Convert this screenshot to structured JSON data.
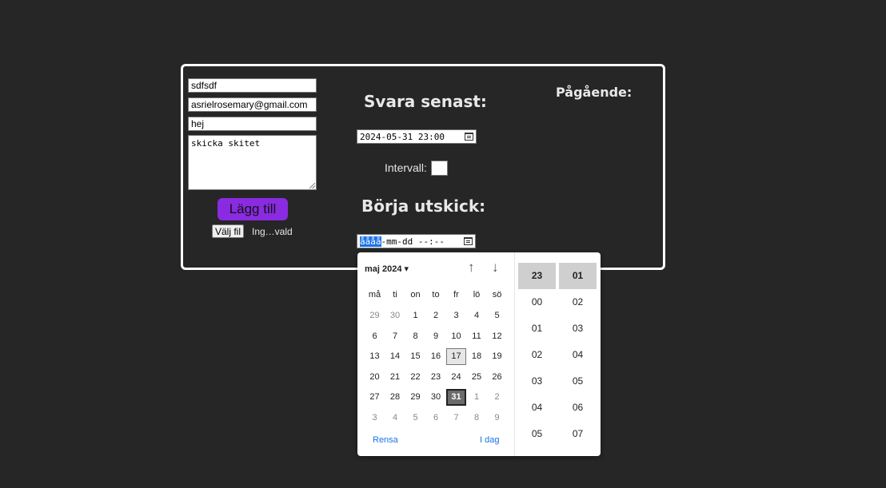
{
  "form": {
    "name_value": "sdfsdf",
    "email_value": "asrielrosemary@gmail.com",
    "subject_value": "hej",
    "message_value": "skicka skitet",
    "add_button": "Lägg till",
    "file_button": "Välj fil",
    "file_status": "Ing…vald"
  },
  "deadline": {
    "heading": "Svara senast:",
    "value": "2024-05-31 23:00",
    "interval_label": "Intervall:"
  },
  "start": {
    "heading": "Börja utskick:",
    "placeholder_selected": "åååå",
    "placeholder_rest": "-mm-dd --:--"
  },
  "ongoing": {
    "heading": "Pågående:"
  },
  "picker": {
    "month_label": "maj 2024 ▾",
    "up_arrow": "↑",
    "down_arrow": "↓",
    "weekdays": [
      "må",
      "ti",
      "on",
      "to",
      "fr",
      "lö",
      "sö"
    ],
    "weeks": [
      [
        "29",
        "30",
        "1",
        "2",
        "3",
        "4",
        "5"
      ],
      [
        "6",
        "7",
        "8",
        "9",
        "10",
        "11",
        "12"
      ],
      [
        "13",
        "14",
        "15",
        "16",
        "17",
        "18",
        "19"
      ],
      [
        "20",
        "21",
        "22",
        "23",
        "24",
        "25",
        "26"
      ],
      [
        "27",
        "28",
        "29",
        "30",
        "31",
        "1",
        "2"
      ],
      [
        "3",
        "4",
        "5",
        "6",
        "7",
        "8",
        "9"
      ]
    ],
    "today": "17",
    "selected": "31",
    "clear_label": "Rensa",
    "today_label": "I dag",
    "hours": [
      "23",
      "00",
      "01",
      "02",
      "03",
      "04",
      "05"
    ],
    "minutes": [
      "01",
      "02",
      "03",
      "04",
      "05",
      "06",
      "07"
    ]
  }
}
